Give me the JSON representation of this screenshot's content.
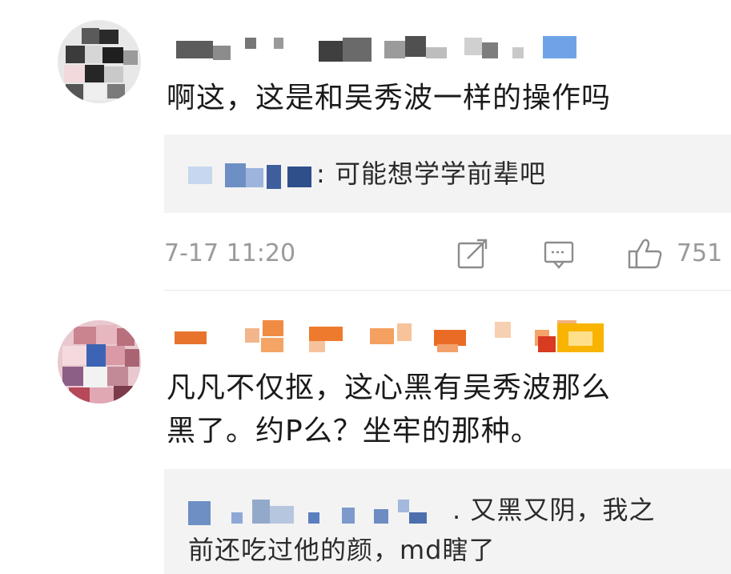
{
  "comments": [
    {
      "username": "",
      "text": "啊这，这是和吴秀波一样的操作吗",
      "reply": {
        "name": "",
        "text": ": 可能想学学前辈吧"
      },
      "time": "7-17 11:20",
      "likes": "751"
    },
    {
      "username": "",
      "text_line1": "凡凡不仅抠，这心黑有吴秀波那么",
      "text_line2": "黑了。约P么？坐牢的那种。",
      "reply": {
        "name": "",
        "text_line1": ". 又黑又阴，我之",
        "text_line2": "前还吃过他的颜，md瞎了"
      }
    }
  ],
  "icons": {
    "share": "share-icon",
    "comment": "comment-icon",
    "like": "thumbs-up-icon"
  },
  "colors": {
    "meta_text": "#9a9a9a",
    "reply_bg": "#f3f3f3",
    "icon_stroke": "#8c8c8c"
  }
}
